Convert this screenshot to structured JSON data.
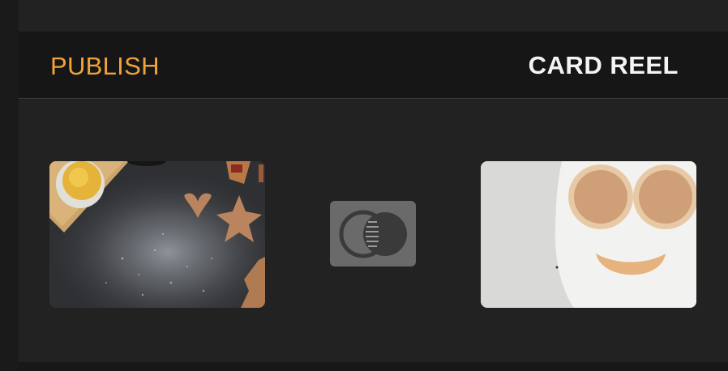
{
  "header": {
    "publish_label": "PUBLISH",
    "title": "CARD REEL"
  },
  "cards": [
    {
      "name": "baking-cookies-image",
      "icon": "baking-photo"
    },
    {
      "name": "pancake-face-image",
      "icon": "pancake-photo"
    }
  ],
  "center_button": {
    "icon": "blend-mode-icon"
  },
  "colors": {
    "accent": "#f0a33a",
    "title": "#f4f4f4",
    "header_bg": "#161616",
    "content_bg": "#222222",
    "button_bg": "#6a6a6a"
  }
}
